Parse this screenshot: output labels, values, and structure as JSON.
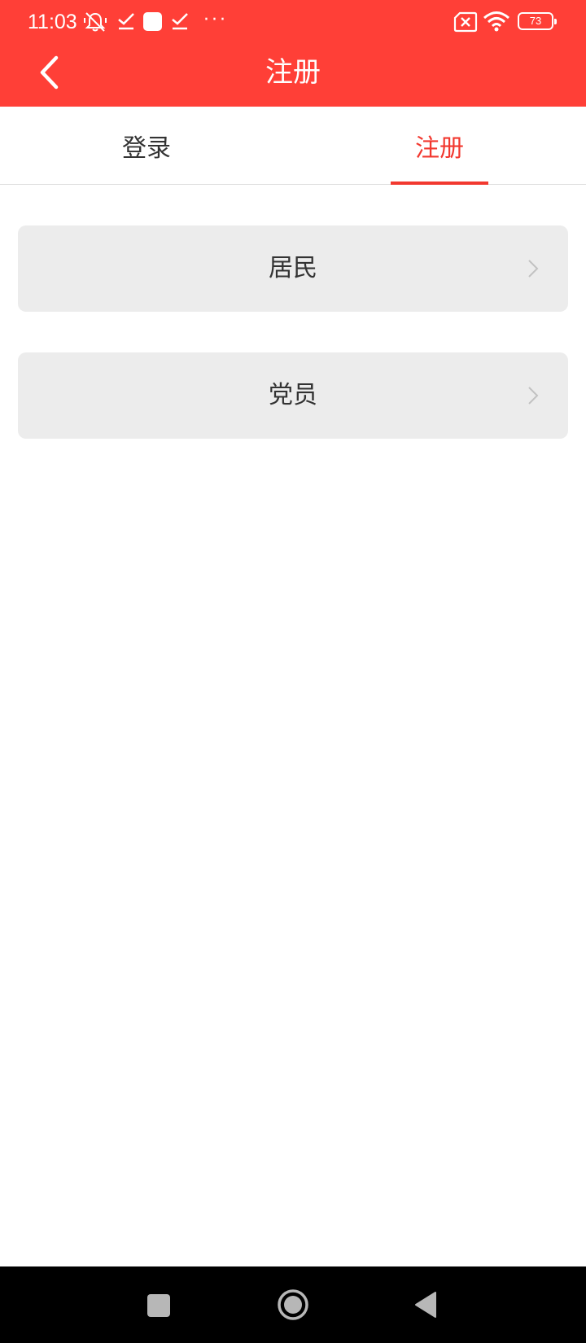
{
  "status_bar": {
    "time": "11:03",
    "battery": "73",
    "icons": [
      "bell-muted-icon",
      "check-icon",
      "square-icon",
      "check-icon",
      "more-icon",
      "sim-error-icon",
      "wifi-icon",
      "battery-icon"
    ],
    "more": "···"
  },
  "header": {
    "title": "注册",
    "background_color": "#ff3f37",
    "back_icon": "chevron-left-icon"
  },
  "tabs": {
    "items": [
      {
        "label": "登录",
        "active": false
      },
      {
        "label": "注册",
        "active": true
      }
    ],
    "active_color": "#f2382f"
  },
  "options": [
    {
      "label": "居民",
      "icon": "chevron-right-icon"
    },
    {
      "label": "党员",
      "icon": "chevron-right-icon"
    }
  ],
  "nav_bar": {
    "buttons": [
      "recents-square-icon",
      "home-circle-icon",
      "back-triangle-icon"
    ]
  }
}
